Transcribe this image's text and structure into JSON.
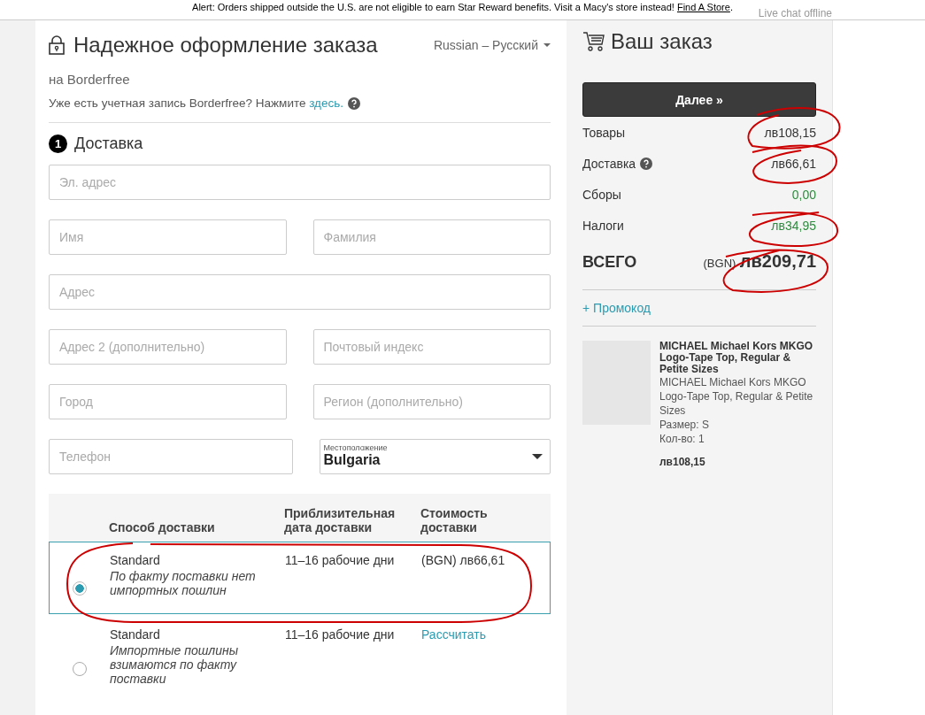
{
  "alert": {
    "text": "Alert: Orders shipped outside the U.S. are not eligible to earn Star Reward benefits. Visit a Macy's store instead!",
    "link": "Find A Store",
    "end": "."
  },
  "live_chat": "Live chat offline",
  "checkout": {
    "title": "Надежное оформление заказа",
    "language": "Russian – Русский",
    "subtitle": "на Borderfree",
    "account_prompt": "Уже есть учетная запись Borderfree? Нажмите",
    "account_link": "здесь."
  },
  "step": {
    "number": "1",
    "title": "Доставка"
  },
  "form_rows": [
    [
      {
        "kind": "text",
        "placeholder": "Эл. адрес"
      }
    ],
    [
      {
        "kind": "text",
        "placeholder": "Имя"
      },
      {
        "kind": "text",
        "placeholder": "Фамилия"
      }
    ],
    [
      {
        "kind": "text",
        "placeholder": "Адрес"
      }
    ],
    [
      {
        "kind": "text",
        "placeholder": "Адрес 2 (дополнительно)"
      },
      {
        "kind": "text",
        "placeholder": "Почтовый индекс"
      }
    ],
    [
      {
        "kind": "text",
        "placeholder": "Город"
      },
      {
        "kind": "text",
        "placeholder": "Регион (дополнительно)"
      }
    ],
    [
      {
        "kind": "text",
        "placeholder": "Телефон"
      },
      {
        "kind": "select",
        "label": "Местоположение",
        "value": "Bulgaria"
      }
    ]
  ],
  "shipping_table": {
    "columns": [
      "Способ доставки",
      "Приблизительная дата доставки",
      "Стоимость доставки"
    ],
    "rows": [
      {
        "selected": true,
        "name": "Standard",
        "note": "По факту поставки нет импортных пошлин",
        "eta": "11–16 рабочие дни",
        "cost": {
          "kind": "price",
          "text": "(BGN) лв66,61"
        }
      },
      {
        "selected": false,
        "name": "Standard",
        "note": "Импортные пошлины взимаются по факту поставки",
        "eta": "11–16 рабочие дни",
        "cost": {
          "kind": "link",
          "text": "Рассчитать"
        }
      }
    ]
  },
  "order": {
    "title": "Ваш заказ",
    "button": "Далее »",
    "lines": [
      {
        "label": "Товары",
        "value": "лв108,15",
        "help": false,
        "positive": false
      },
      {
        "label": "Доставка",
        "value": "лв66,61",
        "help": true,
        "positive": false
      },
      {
        "label": "Сборы",
        "value": "0,00",
        "help": false,
        "positive": true
      },
      {
        "label": "Налоги",
        "value": "лв34,95",
        "help": false,
        "positive": true
      }
    ],
    "total": {
      "label": "ВСЕГО",
      "currency": "(BGN)",
      "amount": "лв209,71"
    },
    "promo": "+ Промокод",
    "item": {
      "title": "MICHAEL Michael Kors MKGO Logo-Tape Top, Regular & Petite Sizes",
      "description": "MICHAEL Michael Kors MKGO Logo-Tape Top, Regular & Petite Sizes",
      "size": "Размер: S",
      "quantity": "Кол-во: 1",
      "price": "лв108,15"
    }
  }
}
